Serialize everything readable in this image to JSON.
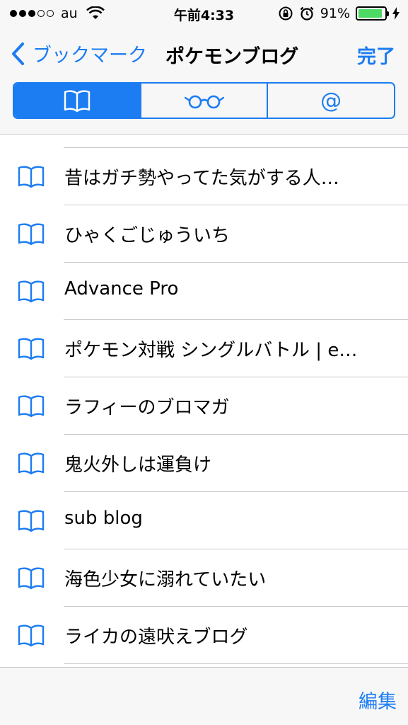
{
  "status_bar": {
    "carrier": "au",
    "time": "午前4:33",
    "battery_percent": "91%",
    "battery_level": 0.91,
    "signal_bars": 3,
    "signal_total": 5
  },
  "nav": {
    "back_label": "ブックマーク",
    "title": "ポケモンブログ",
    "done_label": "完了"
  },
  "segments": {
    "items": [
      "book-icon",
      "glasses-icon",
      "at-icon"
    ],
    "selected": 0,
    "at_symbol": "@"
  },
  "bookmarks": [
    {
      "title": "昔はガチ勢やってた気がする人…"
    },
    {
      "title": "ひゃくごじゅういち"
    },
    {
      "title": "Advance Pro"
    },
    {
      "title": "ポケモン対戦 シングルバトル | e…"
    },
    {
      "title": "ラフィーのブロマガ"
    },
    {
      "title": "鬼火外しは運負け"
    },
    {
      "title": "sub blog"
    },
    {
      "title": "海色少女に溺れていたい"
    },
    {
      "title": "ライカの遠吠えブログ"
    }
  ],
  "toolbar": {
    "edit_label": "編集"
  },
  "colors": {
    "accent": "#1c7cf2",
    "battery": "#4cd964",
    "separator": "#c8c7cc",
    "bar_background": "#f7f7f7"
  }
}
